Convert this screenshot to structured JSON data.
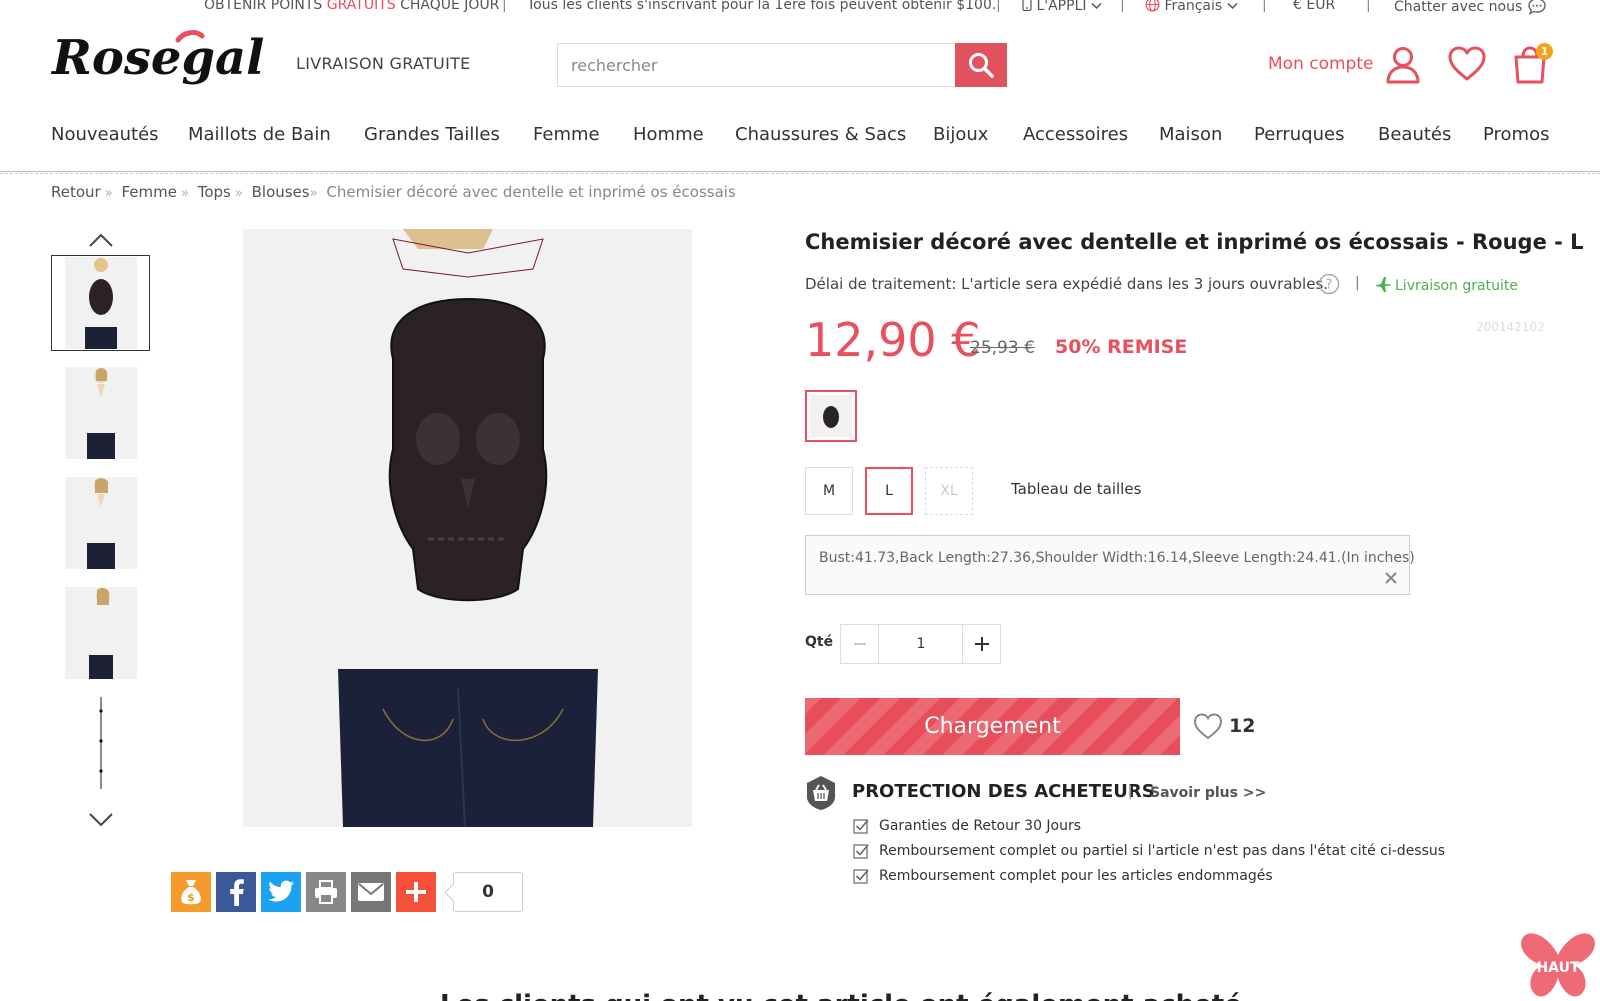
{
  "topbar": {
    "points_prefix": "OBTENIR POINTS",
    "points_highlight": "GRATUITS",
    "points_suffix": "CHAQUE JOUR",
    "promo": "Tous les clients s'inscrivant pour la 1ère fois peuvent obtenir $100.",
    "app": "L'APPLI",
    "language": "Français",
    "currency": "€ EUR",
    "chat": "Chatter avec nous"
  },
  "header": {
    "logo_text": "Rosegal",
    "free_shipping": "LIVRAISON GRATUITE",
    "search_placeholder": "rechercher",
    "account": "Mon compte",
    "cart_count": "1"
  },
  "nav": [
    "Nouveautés",
    "Maillots de Bain",
    "Grandes Tailles",
    "Femme",
    "Homme",
    "Chaussures & Sacs",
    "Bijoux",
    "Accessoires",
    "Maison",
    "Perruques",
    "Beautés",
    "Promos"
  ],
  "breadcrumb": {
    "items": [
      "Retour",
      "Femme",
      "Tops",
      "Blouses"
    ],
    "current": "Chemisier décoré avec dentelle et inprimé os écossais"
  },
  "product": {
    "title": "Chemisier décoré avec dentelle et inprimé os écossais - Rouge - L",
    "delay": "Délai de traitement: L'article sera expédié dans les 3 jours ouvrables.",
    "free_delivery": "Livraison gratuite",
    "sku": "200142102",
    "price": "12,90 €",
    "old_price": "25,93 €",
    "discount": "50% REMISE",
    "sizes": [
      "M",
      "L",
      "XL"
    ],
    "selected_size": "L",
    "size_chart": "Tableau de tailles",
    "measurements": "Bust:41.73,Back Length:27.36,Shoulder Width:16.14,Sleeve Length:24.41.(In inches)",
    "qty_label": "Qté",
    "qty_value": "1",
    "cart_button": "Chargement",
    "wish_count": "12"
  },
  "protection": {
    "title": "PROTECTION DES ACHETEURS",
    "more": "Savoir plus >>",
    "items": [
      "Garanties de Retour 30 Jours",
      "Remboursement complet ou partiel si l'article n'est pas dans l'état cité ci-dessus",
      "Remboursement complet pour les articles endommagés"
    ]
  },
  "share": {
    "count": "0"
  },
  "bottom_heading": "Les clients qui ont vu cet article ont également acheté",
  "back_to_top": "HAUT",
  "colors": {
    "brand": "#e94f5c",
    "green": "#4caf50",
    "shirt_red": "#d9323f",
    "shirt_navy": "#22283f"
  }
}
